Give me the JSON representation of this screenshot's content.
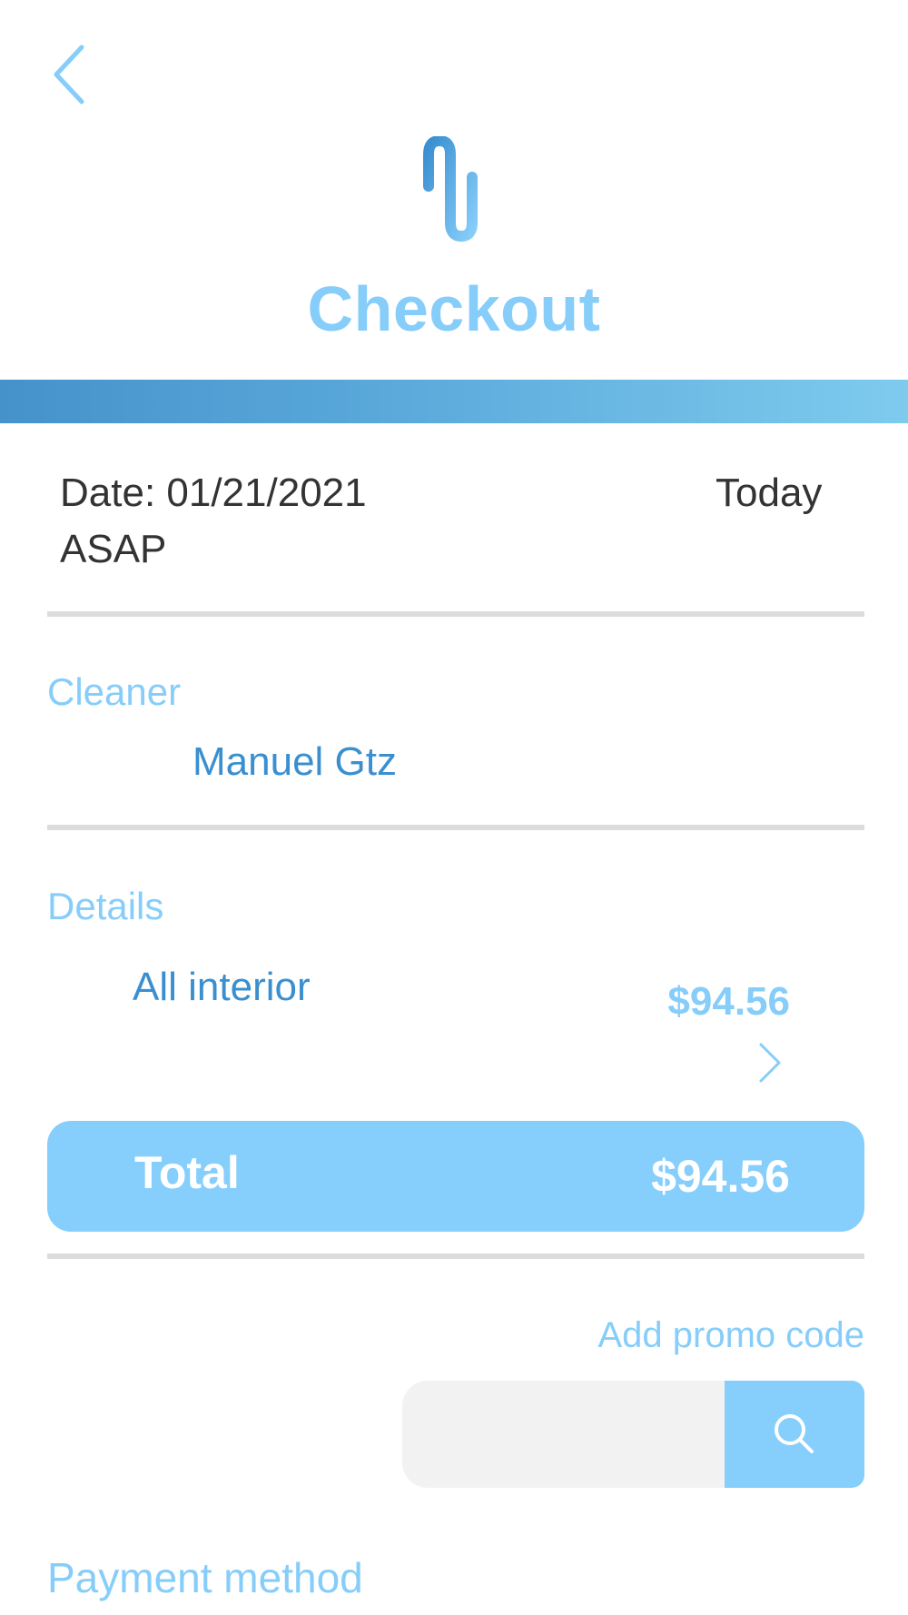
{
  "header": {
    "back_icon": "chevron-left-icon",
    "logo_icon": "brand-logo-icon",
    "title": "Checkout"
  },
  "schedule": {
    "date": "Date: 01/21/2021",
    "day": "Today",
    "time": "ASAP"
  },
  "cleaner": {
    "label": "Cleaner",
    "name": "Manuel Gtz"
  },
  "details": {
    "label": "Details",
    "service": "All interior",
    "price": "$94.56",
    "expand_icon": "chevron-right-icon"
  },
  "total": {
    "label": "Total",
    "value": "$94.56"
  },
  "promo": {
    "link_label": "Add promo code",
    "input_value": "",
    "input_placeholder": "",
    "search_icon": "search-icon"
  },
  "payment": {
    "label": "Payment method"
  },
  "colors": {
    "accent_light": "#86cdfa",
    "accent_dark": "#3a8fd0",
    "gradient_start": "#4592cb",
    "gradient_end": "#7ecbee",
    "text_dark": "#333333",
    "divider": "#dcdcdc",
    "input_bg": "#f2f2f2"
  }
}
